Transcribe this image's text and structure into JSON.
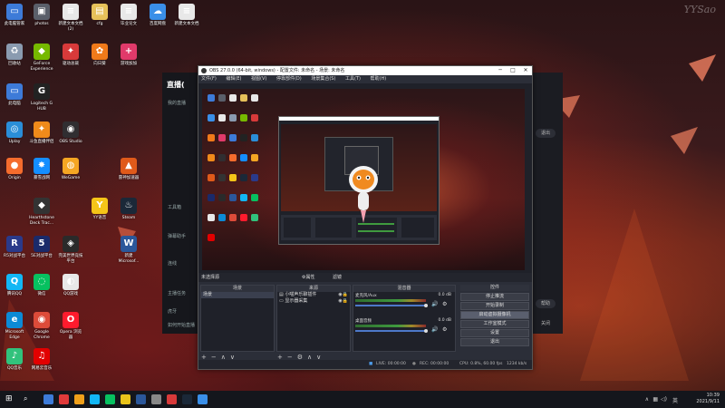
{
  "watermark": "YYSao",
  "desktop_icons": [
    {
      "label": "此电脑管家",
      "color": "#3d7bd8",
      "glyph": "▭"
    },
    {
      "label": "photos",
      "color": "#5a5f6a",
      "glyph": "▣"
    },
    {
      "label": "新建文本文档\n(2)",
      "color": "#e8e8e8",
      "glyph": "≡"
    },
    {
      "label": "cfg",
      "color": "#e6c15a",
      "glyph": "▤"
    },
    {
      "label": "毕业论文",
      "color": "#e8e8e8",
      "glyph": "≡"
    },
    {
      "label": "百度网盘",
      "color": "#3a8fe8",
      "glyph": "☁"
    },
    {
      "label": "新建文本文档",
      "color": "#e8e8e8",
      "glyph": "≡"
    },
    {
      "label": "回收站",
      "color": "#8a9bb0",
      "glyph": "♻"
    },
    {
      "label": "GeForce\nExperience",
      "color": "#76b900",
      "glyph": "◆"
    },
    {
      "label": "驱动总裁",
      "color": "#d83a3a",
      "glyph": "✦"
    },
    {
      "label": "向日葵",
      "color": "#f07a1a",
      "glyph": "✿"
    },
    {
      "label": "游戏加加",
      "color": "#e03a6a",
      "glyph": "+"
    },
    {
      "label": "此电脑",
      "color": "#3d7bd8",
      "glyph": "▭"
    },
    {
      "label": "Logitech G\nHUB",
      "color": "#222",
      "glyph": "G"
    },
    {
      "label": "Uplay",
      "color": "#2a8ed8",
      "glyph": "◎"
    },
    {
      "label": "斗鱼直播伴侣",
      "color": "#f08a1a",
      "glyph": "✦"
    },
    {
      "label": "OBS Studio",
      "color": "#302e31",
      "glyph": "◉"
    },
    {
      "label": "Origin",
      "color": "#f56c2d",
      "glyph": "●"
    },
    {
      "label": "暴雪战网",
      "color": "#148eff",
      "glyph": "✸"
    },
    {
      "label": "WeGame",
      "color": "#f5a623",
      "glyph": "◍"
    },
    {
      "label": "雷神加速器",
      "color": "#e05a1a",
      "glyph": "▲"
    },
    {
      "label": "Hearthstone\nDeck Trac...",
      "color": "#333",
      "glyph": "◆"
    },
    {
      "label": "YY语音",
      "color": "#f5c518",
      "glyph": "Y"
    },
    {
      "label": "Steam",
      "color": "#1b2838",
      "glyph": "♨"
    },
    {
      "label": "R5对战平台",
      "color": "#2a3a8a",
      "glyph": "R"
    },
    {
      "label": "5E对战平台",
      "color": "#1a2a6a",
      "glyph": "5"
    },
    {
      "label": "完美世界竞技\n平台",
      "color": "#2a2a2a",
      "glyph": "◈"
    },
    {
      "label": "新建\nMicrosof...",
      "color": "#2b579a",
      "glyph": "W"
    },
    {
      "label": "腾讯QQ",
      "color": "#12b7f5",
      "glyph": "Q"
    },
    {
      "label": "微信",
      "color": "#07c160",
      "glyph": "◌"
    },
    {
      "label": "QQ游戏",
      "color": "#e8e8e8",
      "glyph": "◐"
    },
    {
      "label": "Microsoft\nEdge",
      "color": "#0c8ad6",
      "glyph": "e"
    },
    {
      "label": "Google\nChrome",
      "color": "#dd4b39",
      "glyph": "◉"
    },
    {
      "label": "Opera 浏览\n器",
      "color": "#ff1b2d",
      "glyph": "O"
    },
    {
      "label": "QQ音乐",
      "color": "#31c27c",
      "glyph": "♪"
    },
    {
      "label": "网易云音乐",
      "color": "#e20000",
      "glyph": "♫"
    }
  ],
  "live_app": {
    "logo": "直播(",
    "side_items": [
      "我的直播",
      "工具箱",
      "弹幕助手",
      "连线",
      "主播任务",
      "虎牙",
      "如何开始直播"
    ],
    "right_btns": [
      "退出",
      "帮助",
      "关闭"
    ]
  },
  "obs": {
    "title": "OBS 27.0.0 (64-bit, windows) - 配置文件: 未命名 - 场景: 未命名",
    "window_controls": [
      "─",
      "□",
      "✕"
    ],
    "menu": [
      "文件(F)",
      "编辑(E)",
      "视图(V)",
      "停靠部件(D)",
      "场景集合(S)",
      "工具(T)",
      "帮助(H)"
    ],
    "no_source": "未选择源",
    "properties_btn": "⚙属性",
    "filters_btn": "滤镜",
    "scenes": {
      "header": "场景",
      "items": [
        "场景"
      ]
    },
    "sources": {
      "header": "来源",
      "items": [
        "小喵声乐聊插件",
        "显示器采集"
      ]
    },
    "mixer": {
      "header": "混音器",
      "channels": [
        {
          "name": "麦克风/Aux",
          "db": "0.0 dB",
          "level": 0.55
        },
        {
          "name": "桌面音频",
          "db": "0.0 dB",
          "level": 0.6
        }
      ]
    },
    "controls": {
      "header": "控件",
      "buttons": [
        "停止推流",
        "开始录制",
        "启动虚拟摄像机",
        "工作室模式",
        "设置",
        "退出"
      ]
    },
    "status": {
      "live": "LIVE: 00:00:00",
      "rec": "REC: 00:00:00",
      "cpu": "CPU: 0.8%, 60.00 fps",
      "drop": "1234 kb/s"
    }
  },
  "taskbar": {
    "clock": "10:39",
    "date": "2021/9/11",
    "lang": "英",
    "items_colors": [
      "#3d7bd8",
      "#e03a3a",
      "#f0a01a",
      "#12b7f5",
      "#07c160",
      "#e8c31a",
      "#2b579a",
      "#888",
      "#d83a3a",
      "#1b2838",
      "#3a8fe8"
    ]
  }
}
